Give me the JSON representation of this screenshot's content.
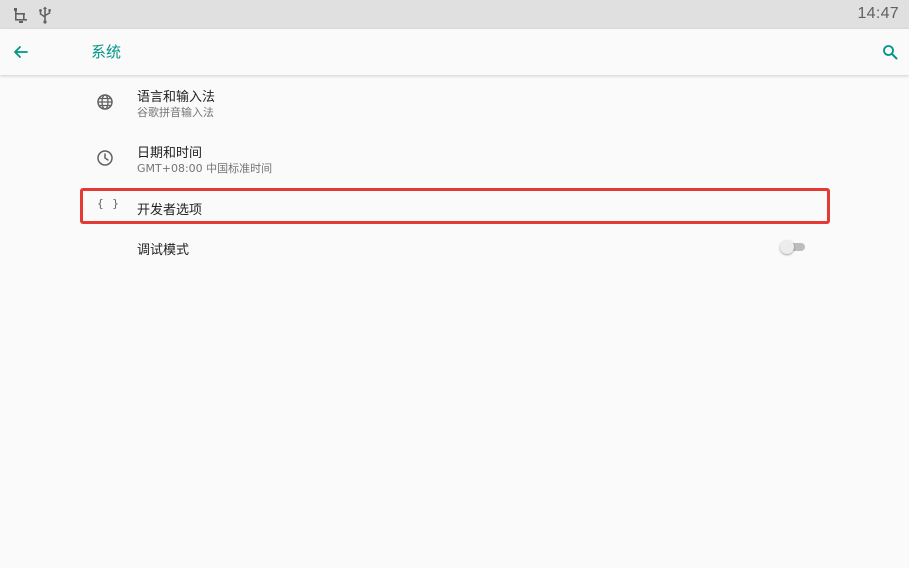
{
  "status_bar": {
    "time": "14:47",
    "icons": [
      "network-icon",
      "usb-icon"
    ]
  },
  "toolbar": {
    "title": "系统",
    "back_icon": "arrow-back-icon",
    "search_icon": "search-icon"
  },
  "items": [
    {
      "icon": "globe-icon",
      "title": "语言和输入法",
      "subtitle": "谷歌拼音输入法"
    },
    {
      "icon": "clock-icon",
      "title": "日期和时间",
      "subtitle": "GMT+08:00 中国标准时间"
    },
    {
      "icon": "braces-icon",
      "icon_text": "{ }",
      "title": "开发者选项",
      "highlighted": true
    },
    {
      "title": "调试模式",
      "toggle_on": false
    }
  ],
  "colors": {
    "accent": "#009688",
    "highlight_border": "#e53935",
    "status_bar_bg": "#e0e0e0",
    "background": "#fafafa"
  }
}
